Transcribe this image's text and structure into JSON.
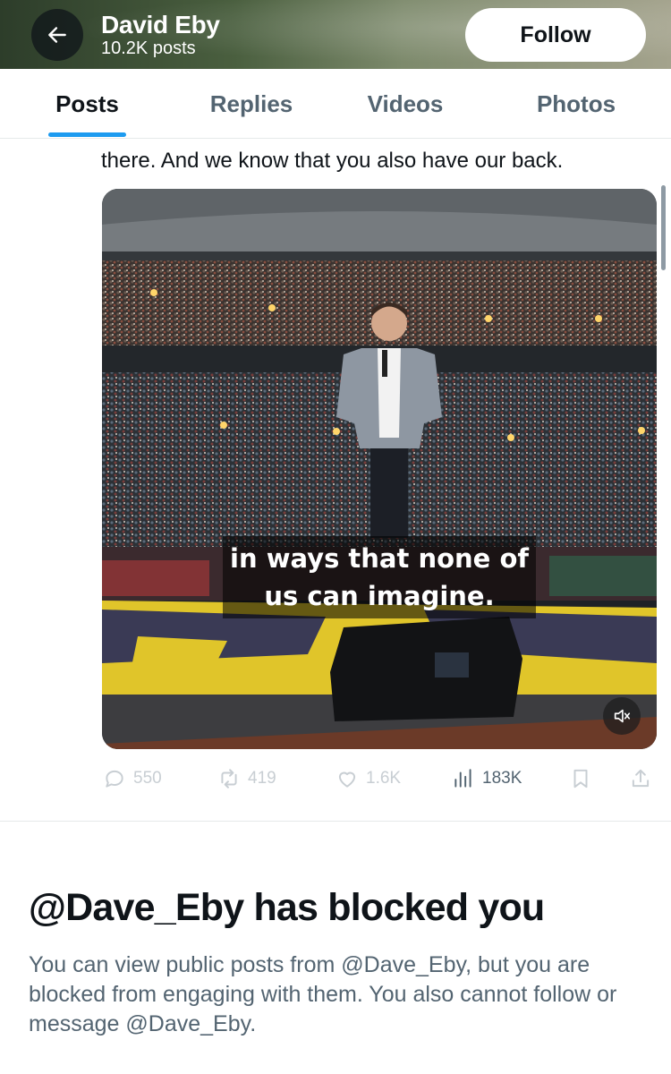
{
  "header": {
    "back_icon": "arrow-left-icon",
    "profile_name": "David Eby",
    "post_count": "10.2K posts",
    "follow_label": "Follow"
  },
  "tabs": [
    {
      "label": "Posts",
      "active": true
    },
    {
      "label": "Replies",
      "active": false
    },
    {
      "label": "Videos",
      "active": false
    },
    {
      "label": "Photos",
      "active": false
    }
  ],
  "post": {
    "text_visible": "there. And we know that you also have our back.",
    "media": {
      "caption_line1": "in ways that none of",
      "caption_line2": "us can imagine.",
      "mute_icon": "speaker-muted-icon"
    },
    "actions": {
      "replies": "550",
      "reposts": "419",
      "likes": "1.6K",
      "views": "183K"
    }
  },
  "blocked": {
    "title": "@Dave_Eby has blocked you",
    "description": "You can view public posts from @Dave_Eby, but you are blocked from engaging with them. You also cannot follow or message @Dave_Eby."
  },
  "colors": {
    "accent": "#1d9bf0",
    "text_primary": "#0f1419",
    "text_secondary": "#536471"
  }
}
